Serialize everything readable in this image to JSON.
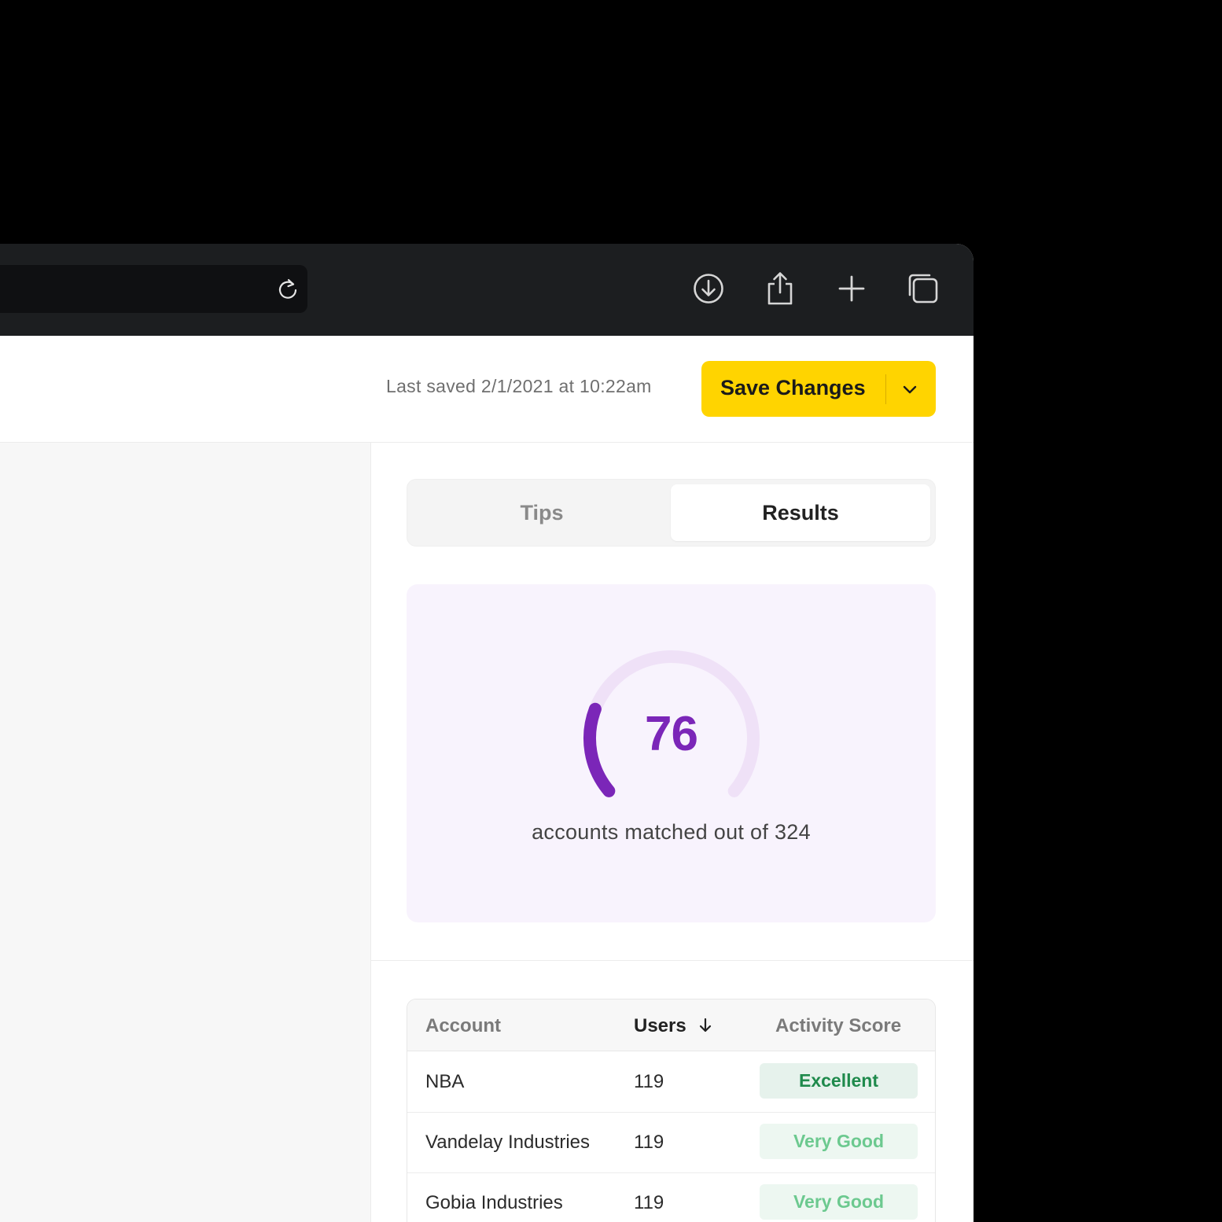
{
  "header": {
    "last_saved": "Last saved 2/1/2021 at 10:22am",
    "save_label": "Save Changes"
  },
  "tabs": [
    {
      "label": "Tips",
      "active": false
    },
    {
      "label": "Results",
      "active": true
    }
  ],
  "score": {
    "value": "76",
    "total": 324,
    "caption": "accounts matched out of 324",
    "accent_color": "#7b26b8",
    "track_color": "#efe1f7"
  },
  "table": {
    "columns": [
      "Account",
      "Users",
      "Activity Score"
    ],
    "sorted_by": "Users",
    "rows": [
      {
        "account": "NBA",
        "users": "119",
        "activity": "Excellent",
        "level": "excellent"
      },
      {
        "account": "Vandelay Industries",
        "users": "119",
        "activity": "Very Good",
        "level": "verygood"
      },
      {
        "account": "Gobia Industries",
        "users": "119",
        "activity": "Very Good",
        "level": "verygood"
      }
    ]
  },
  "toolbar_icons": [
    "reload-icon",
    "download-icon",
    "share-icon",
    "new-tab-icon",
    "tabs-overview-icon"
  ],
  "colors": {
    "save_button": "#ffd400",
    "excellent": "#1f8a4c",
    "very_good": "#6cc98f"
  }
}
